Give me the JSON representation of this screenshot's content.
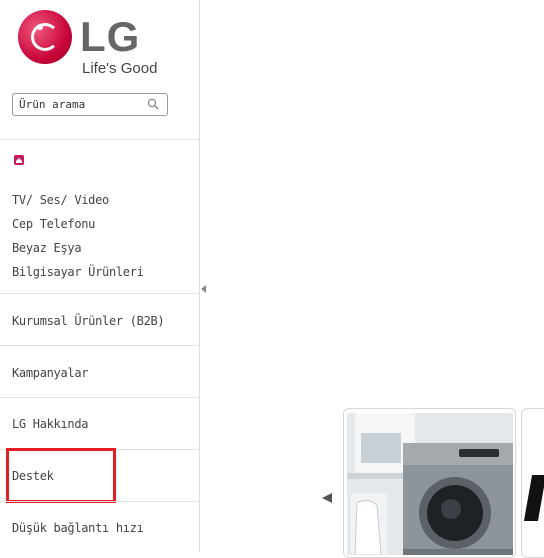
{
  "logo": {
    "brand": "LG",
    "tagline": "Life's Good"
  },
  "search": {
    "value": "Ürün arama",
    "placeholder": "Ürün arama",
    "icon": "search-icon"
  },
  "home": {
    "icon": "home-icon",
    "color": "#c8175d"
  },
  "categories": [
    {
      "label": "TV/ Ses/ Video"
    },
    {
      "label": "Cep Telefonu"
    },
    {
      "label": "Beyaz Eşya"
    },
    {
      "label": "Bilgisayar Ürünleri"
    }
  ],
  "sections": [
    {
      "label": "Kurumsal Ürünler (B2B)"
    },
    {
      "label": "Kampanyalar"
    },
    {
      "label": "LG Hakkında"
    },
    {
      "label": "Destek"
    },
    {
      "label": "Düşük bağlantı hızı"
    }
  ],
  "colors": {
    "brand": "#c9063a",
    "highlight": "#e31e24"
  },
  "carousel": {
    "prev_icon": "arrow-left-icon",
    "collapse_icon": "collapse-arrow-icon"
  }
}
